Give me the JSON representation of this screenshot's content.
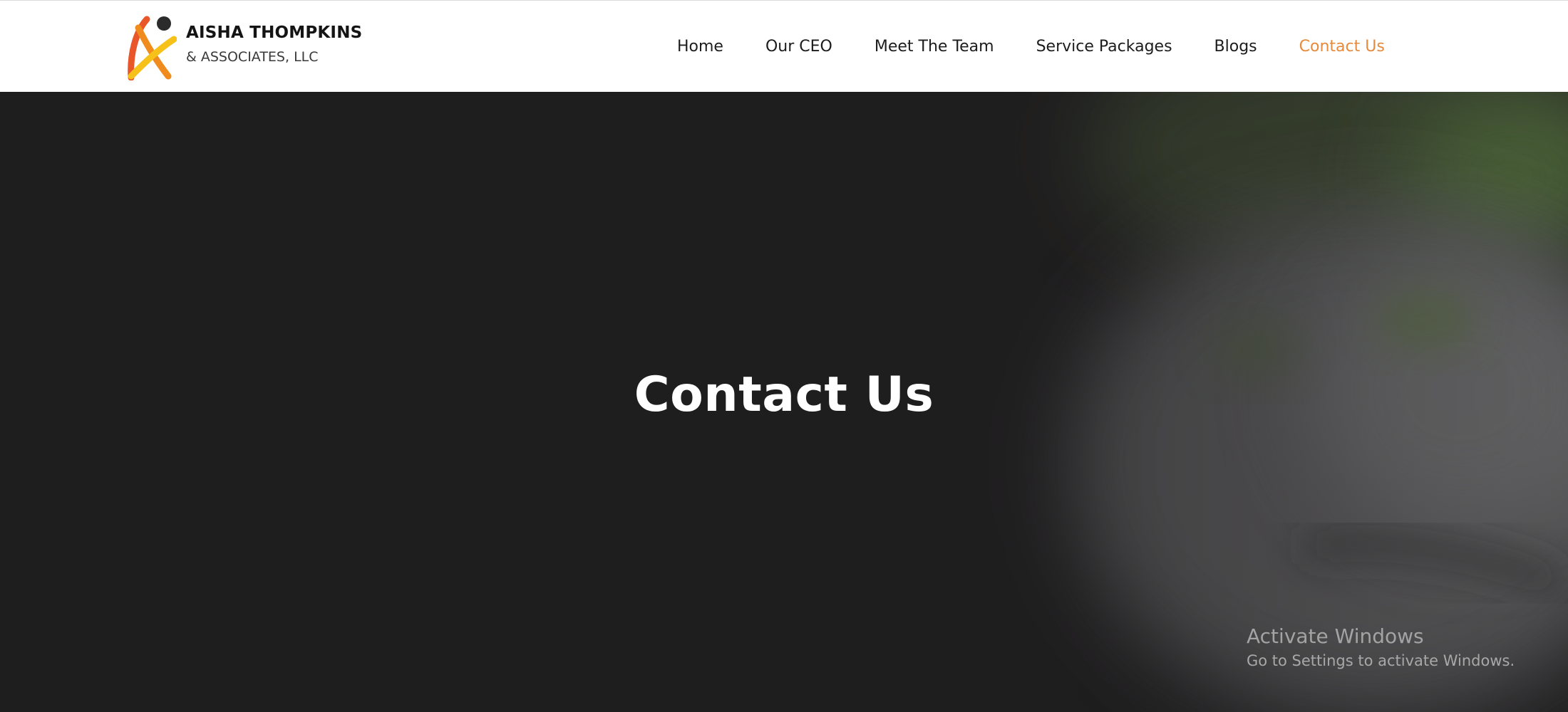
{
  "header": {
    "logo": {
      "name": "AISHA THOMPKINS",
      "subtitle": "& ASSOCIATES, LLC"
    },
    "nav": [
      {
        "label": "Home"
      },
      {
        "label": "Our CEO"
      },
      {
        "label": "Meet The Team"
      },
      {
        "label": "Service Packages"
      },
      {
        "label": "Blogs"
      },
      {
        "label": "Contact Us",
        "active": true
      }
    ],
    "active_color": "#e68a3c"
  },
  "hero": {
    "title": "Contact Us"
  },
  "watermark": {
    "title": "Activate Windows",
    "subtitle": "Go to Settings to activate Windows."
  }
}
